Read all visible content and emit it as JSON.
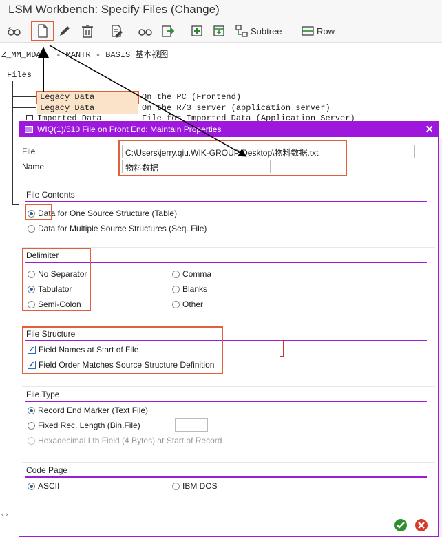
{
  "window": {
    "title": "LSM Workbench: Specify Files (Change)"
  },
  "toolbar": {
    "subtree_label": "Subtree",
    "row_label": "Row"
  },
  "object_line": "Z_MM_MDA   - MANTR - BASIS 基本视图",
  "tree": {
    "root": "Files",
    "rows": [
      {
        "label": "Legacy Data",
        "desc": "On the PC (Frontend)"
      },
      {
        "label": "Legacy Data",
        "desc": "On the R/3 server (application server)"
      },
      {
        "label": "Imported Data",
        "desc": "File for Imported Data (Application Server)"
      }
    ]
  },
  "dialog": {
    "title": "WIQ(1)/510 File on Front End: Maintain Properties",
    "file_label": "File",
    "file_value": "C:\\Users\\jerry.qiu.WIK-GROUP\\Desktop\\物料数据.txt",
    "name_label": "Name",
    "name_value": "物料数据",
    "file_contents": {
      "title": "File Contents",
      "opt1": "Data for One Source Structure (Table)",
      "opt2": "Data for Multiple Source Structures (Seq. File)"
    },
    "delimiter": {
      "title": "Delimiter",
      "no_sep": "No Separator",
      "tab": "Tabulator",
      "semi": "Semi-Colon",
      "comma": "Comma",
      "blanks": "Blanks",
      "other": "Other"
    },
    "file_structure": {
      "title": "File Structure",
      "field_names": "Field Names at Start of File",
      "field_order": "Field Order Matches Source Structure Definition"
    },
    "file_type": {
      "title": "File Type",
      "record_end": "Record End Marker (Text File)",
      "fixed_len": "Fixed Rec. Length (Bin.File)",
      "hex": "Hexadecimal Lth Field (4 Bytes) at Start of Record"
    },
    "code_page": {
      "title": "Code Page",
      "ascii": "ASCII",
      "ibm": "IBM DOS"
    }
  },
  "colors": {
    "dialog_accent": "#9d18dc",
    "highlight": "#e0603a",
    "tree_label_bg": "#fae3c8"
  }
}
